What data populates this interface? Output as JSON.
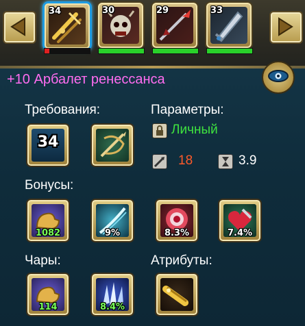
{
  "top_bar": {
    "items": [
      {
        "level": "34",
        "selected": true,
        "bar_fill": 0.1,
        "bar_color": "#e02020",
        "icon": "golden-crossbow-icon"
      },
      {
        "level": "30",
        "selected": false,
        "bar_fill": 1.0,
        "bar_color": "#29d12a",
        "icon": "skull-helmet-icon"
      },
      {
        "level": "29",
        "selected": false,
        "bar_fill": 1.0,
        "bar_color": "#29d12a",
        "icon": "red-spear-icon"
      },
      {
        "level": "33",
        "selected": false,
        "bar_fill": 1.0,
        "bar_color": "#29d12a",
        "icon": "silver-blade-icon"
      }
    ]
  },
  "item_title": "+10 Арбалет ренессанса",
  "requirements": {
    "label": "Требования:",
    "level": "34",
    "class_icon": "crossbow-class-icon"
  },
  "parameters": {
    "label": "Параметры:",
    "binding": "Личный",
    "damage": "18",
    "speed": "3.9"
  },
  "bonuses": {
    "label": "Бонусы:",
    "items": [
      {
        "value": "1082",
        "icon": "muscle-arm-icon",
        "green": true
      },
      {
        "value": "9%",
        "icon": "slash-icon",
        "green": false
      },
      {
        "value": "8.3%",
        "icon": "red-target-icon",
        "green": false
      },
      {
        "value": "7.4%",
        "icon": "heart-shield-icon",
        "green": false
      }
    ]
  },
  "enchants": {
    "label": "Чары:",
    "items": [
      {
        "value": "114",
        "icon": "muscle-arm-icon",
        "green": true
      },
      {
        "value": "8.4%",
        "icon": "ice-crystal-icon",
        "green": true
      }
    ]
  },
  "attributes": {
    "label": "Атрибуты:",
    "items": [
      {
        "icon": "golden-cannon-icon"
      }
    ]
  },
  "colors": {
    "title": "#ff6df0",
    "binding": "#3fe33f",
    "damage": "#ff5a2a",
    "speed": "#ffffff",
    "selected_border": "#1e9be2"
  }
}
